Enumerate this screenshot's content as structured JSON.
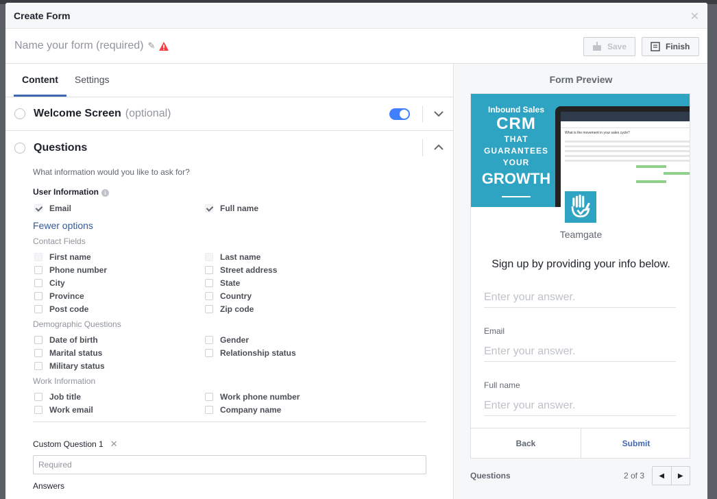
{
  "window": {
    "title": "Create Form"
  },
  "name_bar": {
    "placeholder": "Name your form (required)"
  },
  "toolbar": {
    "save_label": "Save",
    "finish_label": "Finish"
  },
  "tabs": [
    {
      "label": "Content",
      "active": true
    },
    {
      "label": "Settings",
      "active": false
    }
  ],
  "welcome": {
    "title": "Welcome Screen",
    "optional": "(optional)",
    "toggle_on": true
  },
  "questions": {
    "title": "Questions",
    "prompt": "What information would you like to ask for?",
    "user_info_label": "User Information",
    "user_info_items": [
      {
        "label": "Email",
        "checked": true
      },
      {
        "label": "Full name",
        "checked": true
      }
    ],
    "fewer_options": "Fewer options",
    "contact_label": "Contact Fields",
    "contact_items": [
      "First name",
      "Last name",
      "Phone number",
      "Street address",
      "City",
      "State",
      "Province",
      "Country",
      "Post code",
      "Zip code"
    ],
    "demographic_label": "Demographic Questions",
    "demographic_items": [
      "Date of birth",
      "Gender",
      "Marital status",
      "Relationship status",
      "Military status"
    ],
    "work_label": "Work Information",
    "work_items": [
      "Job title",
      "Work phone number",
      "Work email",
      "Company name"
    ],
    "custom_question_label": "Custom Question 1",
    "custom_required_placeholder": "Required",
    "answers_label": "Answers"
  },
  "preview": {
    "title": "Form Preview",
    "banner": {
      "line1": "Inbound Sales",
      "line2": "CRM",
      "line3": "THAT",
      "line4": "GUARANTEES",
      "line5": "YOUR",
      "line6": "GROWTH",
      "screen_question": "What is the movement in your sales cycle?"
    },
    "company": "Teamgate",
    "intro": "Sign up by providing your info below.",
    "fields": [
      {
        "label": "",
        "placeholder": "Enter your answer."
      },
      {
        "label": "Email",
        "placeholder": "Enter your answer."
      },
      {
        "label": "Full name",
        "placeholder": "Enter your answer."
      }
    ],
    "back_label": "Back",
    "submit_label": "Submit",
    "pager_label": "Questions",
    "pager_count": "2 of 3"
  },
  "colors": {
    "accent": "#4267b2",
    "toggle": "#4080ff",
    "banner": "#2ea3c2",
    "warning": "#fa3e3e"
  }
}
